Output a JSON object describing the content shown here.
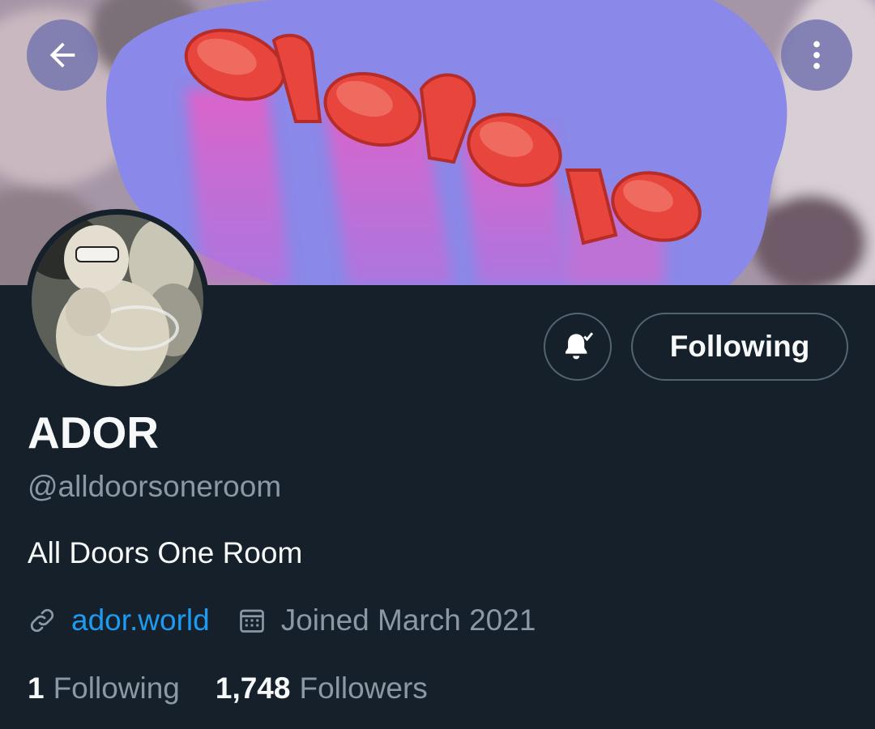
{
  "header": {
    "back_icon": "arrow-left-icon",
    "more_icon": "more-vertical-icon"
  },
  "banner": {
    "logo_text": "ador",
    "colors": {
      "background": "#8a88e8",
      "logo": "#e8453c",
      "glow": "#e65fc6"
    }
  },
  "profile": {
    "avatar_label": "ador",
    "name": "ADOR",
    "handle": "@alldoorsoneroom",
    "bio": "All Doors One Room",
    "website": "ador.world",
    "joined": "Joined March 2021",
    "following_count": "1",
    "following_label": "Following",
    "followers_count": "1,748",
    "followers_label": "Followers"
  },
  "actions": {
    "notify_icon": "bell-check-icon",
    "follow_button_label": "Following"
  },
  "colors": {
    "background": "#15202b",
    "link": "#1d9bf0",
    "muted": "#8b98a5",
    "text": "#f7f9f9",
    "border": "#536471"
  }
}
